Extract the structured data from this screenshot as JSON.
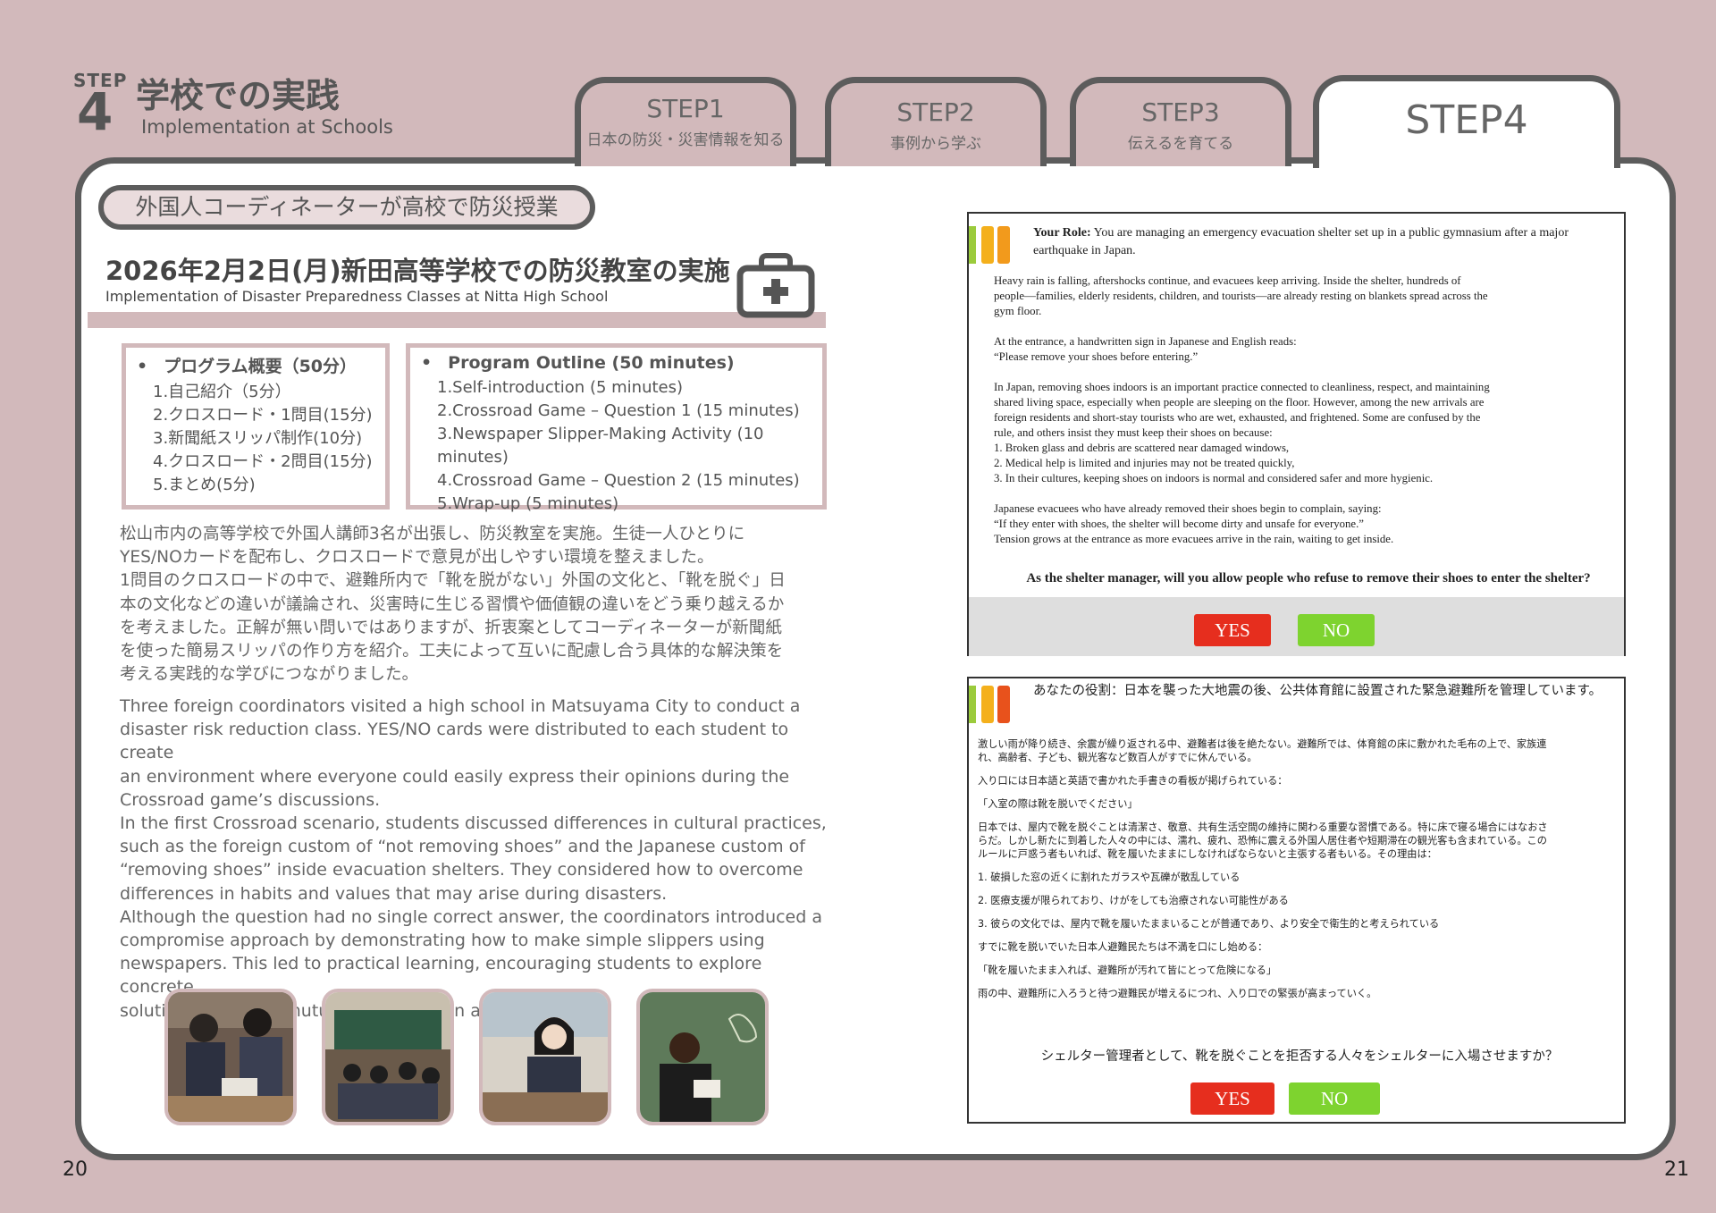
{
  "header": {
    "step_small": "STEP",
    "step_num": "4",
    "title_jp": "学校での実践",
    "title_en": "Implementation at Schools"
  },
  "tabs": [
    {
      "label": "STEP1",
      "sub": "日本の防災・災害情報を知る"
    },
    {
      "label": "STEP2",
      "sub": "事例から学ぶ"
    },
    {
      "label": "STEP3",
      "sub": "伝えるを育てる"
    },
    {
      "label": "STEP4",
      "sub": ""
    }
  ],
  "left": {
    "pill": "外国人コーディネーターが高校で防災授業",
    "heading": "2026年2月2日(月)新田高等学校での防災教室の実施",
    "heading_en": "Implementation of Disaster Preparedness Classes at Nitta High School",
    "outline_jp": {
      "title": "プログラム概要（50分）",
      "items": [
        "1.自己紹介（5分）",
        "2.クロスロード・1問目(15分)",
        "3.新聞紙スリッパ制作(10分)",
        "4.クロスロード・2問目(15分)",
        "5.まとめ(5分)"
      ]
    },
    "outline_en": {
      "title": "Program Outline (50 minutes)",
      "items": [
        "1.Self-introduction (5 minutes)",
        "2.Crossroad Game – Question 1 (15 minutes)",
        "3.Newspaper Slipper-Making Activity (10 minutes)",
        "4.Crossroad Game – Question 2 (15 minutes)",
        "5.Wrap-up (5 minutes)"
      ]
    },
    "para_jp": [
      "松山市内の高等学校で外国人講師3名が出張し、防災教室を実施。生徒一人ひとりに",
      "YES/NOカードを配布し、クロスロードで意見が出しやすい環境を整えました。",
      "1問目のクロスロードの中で、避難所内で「靴を脱がない」外国の文化と、「靴を脱ぐ」日",
      "本の文化などの違いが議論され、災害時に生じる習慣や価値観の違いをどう乗り越えるか",
      "を考えました。正解が無い問いではありますが、折衷案としてコーディネーターが新聞紙",
      "を使った簡易スリッパの作り方を紹介。工夫によって互いに配慮し合う具体的な解決策を",
      "考える実践的な学びにつながりました。"
    ],
    "para_en": [
      "Three foreign coordinators visited a high school in Matsuyama City to conduct a",
      "disaster risk reduction class. YES/NO cards were distributed to each student to create",
      "an environment where everyone could easily express their opinions during the",
      "Crossroad game’s discussions.",
      "In the first Crossroad scenario, students discussed differences in cultural practices,",
      "such as the foreign custom of “not removing shoes” and the Japanese custom of",
      "“removing shoes” inside evacuation shelters. They considered how to overcome",
      "differences in habits and values that may arise during disasters.",
      "Although the question had no single correct answer, the coordinators introduced a",
      "compromise approach by demonstrating how to make simple slippers using",
      "newspapers. This led to practical learning, encouraging students to explore concrete",
      "solutions based on mutual consideration and creativity."
    ]
  },
  "card_en": {
    "role_label": "Your Role:",
    "role_text": " You are managing an emergency evacuation shelter set up in a public gymnasium after a major earthquake in Japan.",
    "lines": [
      "Heavy rain is falling, aftershocks continue, and evacuees keep arriving. Inside the shelter, hundreds of",
      "people—families, elderly residents, children, and tourists—are already resting on blankets spread across the",
      "gym floor.",
      "",
      "At the entrance, a handwritten sign in Japanese and English reads:",
      "“Please remove your shoes before entering.”",
      "",
      "In Japan, removing shoes indoors is an important practice connected to cleanliness, respect, and maintaining",
      "shared living space, especially when people are sleeping on the floor. However, among the new arrivals are",
      "foreign residents and short-stay tourists who are wet, exhausted, and frightened. Some are confused by the",
      "rule, and others insist they must keep their shoes on because:",
      "1. Broken glass and debris are scattered near damaged windows,",
      "2. Medical help is limited and injuries may not be treated quickly,",
      "3. In their cultures, keeping shoes on indoors is normal and considered safer and more hygienic.",
      "",
      "Japanese evacuees who have already removed their shoes begin to complain, saying:",
      "“If they enter with shoes, the shelter will become dirty and unsafe for everyone.”",
      "Tension grows at the entrance as more evacuees arrive in the rain, waiting to get inside."
    ],
    "question": "As the shelter manager, will you allow people who refuse to remove their shoes to enter the shelter?",
    "yes": "YES",
    "no": "NO"
  },
  "card_jp": {
    "role": "あなたの役割：日本を襲った大地震の後、公共体育館に設置された緊急避難所を管理しています。",
    "lines": [
      "激しい雨が降り続き、余震が繰り返される中、避難者は後を絶たない。避難所では、体育館の床に敷かれた毛布の上で、家族連",
      "れ、高齢者、子ども、観光客など数百人がすでに休んでいる。",
      "",
      "入り口には日本語と英語で書かれた手書きの看板が掲げられている：",
      "",
      "「入室の際は靴を脱いでください」",
      "",
      "日本では、屋内で靴を脱ぐことは清潔さ、敬意、共有生活空間の維持に関わる重要な習慣である。特に床で寝る場合にはなおさ",
      "らだ。しかし新たに到着した人々の中には、濡れ、疲れ、恐怖に震える外国人居住者や短期滞在の観光客も含まれている。この",
      "ルールに戸惑う者もいれば、靴を履いたままにしなければならないと主張する者もいる。その理由は：",
      "",
      "1. 破損した窓の近くに割れたガラスや瓦礫が散乱している",
      "",
      "2. 医療支援が限られており、けがをしても治療されない可能性がある",
      "",
      "3. 彼らの文化では、屋内で靴を履いたままいることが普通であり、より安全で衛生的と考えられている",
      "",
      "すでに靴を脱いでいた日本人避難民たちは不満を口にし始める：",
      "",
      "「靴を履いたまま入れば、避難所が汚れて皆にとって危険になる」",
      "",
      "雨の中、避難所に入ろうと待つ避難民が増えるにつれ、入り口での緊張が高まっていく。"
    ],
    "question": "シェルター管理者として、靴を脱ぐことを拒否する人々をシェルターに入場させますか？",
    "yes": "YES",
    "no": "NO"
  },
  "page_left": "20",
  "page_right": "21",
  "colors": {
    "background": "#d2b9bb",
    "frame": "#5c5c5c",
    "yes": "#e62e1e",
    "no": "#7ed32f"
  }
}
